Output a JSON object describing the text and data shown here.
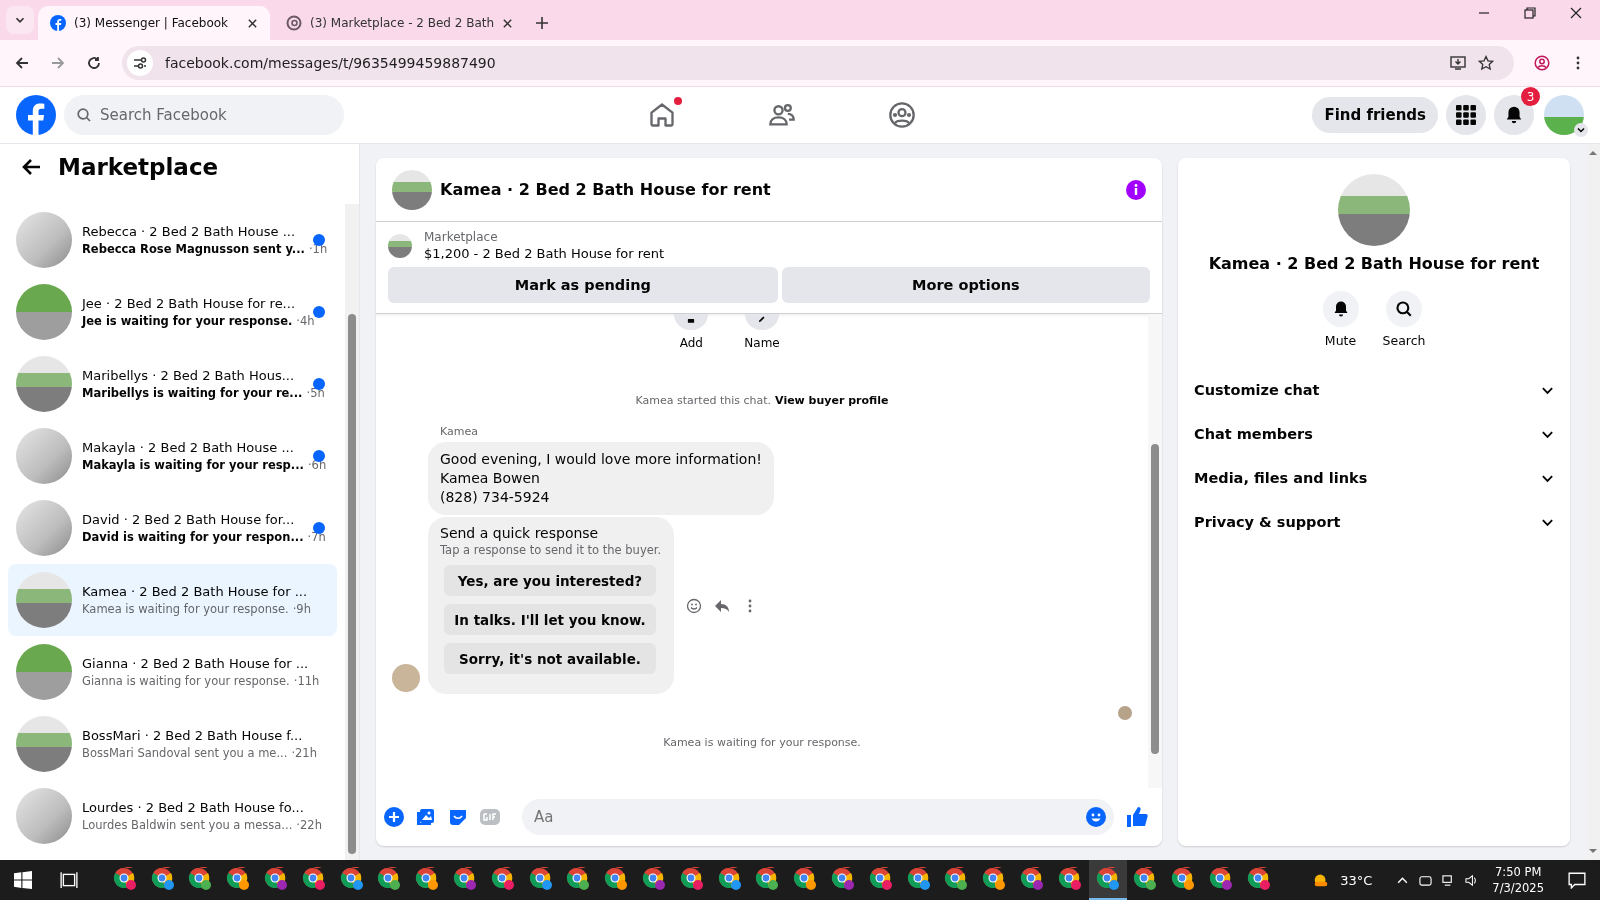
{
  "browser": {
    "tabs": [
      {
        "title": "(3) Messenger | Facebook",
        "selected": true,
        "kind": "facebook"
      },
      {
        "title": "(3) Marketplace - 2 Bed 2 Bath",
        "selected": false,
        "kind": "threads"
      }
    ],
    "url": "facebook.com/messages/t/9635499459887490"
  },
  "header": {
    "search_placeholder": "Search Facebook",
    "home_badge": true,
    "find_friends": "Find friends",
    "notifications_count": "3"
  },
  "sidebar": {
    "title": "Marketplace",
    "conversations": [
      {
        "title": "Rebecca · 2 Bed 2 Bath House ...",
        "preview": "Rebecca Rose Magnusson sent y...",
        "time": "·1h",
        "unread": true,
        "selected": false
      },
      {
        "title": "Jee · 2 Bed 2 Bath House for re...",
        "preview": "Jee is waiting for your response.",
        "time": "·4h",
        "unread": true,
        "selected": false
      },
      {
        "title": "Maribellys · 2 Bed 2 Bath Hous...",
        "preview": "Maribellys is waiting for your re...",
        "time": "·5h",
        "unread": true,
        "selected": false
      },
      {
        "title": "Makayla · 2 Bed 2 Bath House ...",
        "preview": "Makayla is waiting for your resp...",
        "time": "·6h",
        "unread": true,
        "selected": false
      },
      {
        "title": "David · 2 Bed 2 Bath House for...",
        "preview": "David is waiting for your respon...",
        "time": "·7h",
        "unread": true,
        "selected": false
      },
      {
        "title": "Kamea · 2 Bed 2 Bath House for ...",
        "preview": "Kamea is waiting for your response.",
        "time": "·9h",
        "unread": false,
        "selected": true
      },
      {
        "title": "Gianna · 2 Bed 2 Bath House for ...",
        "preview": "Gianna is waiting for your response.",
        "time": "·11h",
        "unread": false,
        "selected": false
      },
      {
        "title": "BossMari · 2 Bed 2 Bath House f...",
        "preview": "BossMari Sandoval sent you a me...",
        "time": "·21h",
        "unread": false,
        "selected": false
      },
      {
        "title": "Lourdes · 2 Bed 2 Bath House fo...",
        "preview": "Lourdes Baldwin sent you a messa...",
        "time": "·22h",
        "unread": false,
        "selected": false
      }
    ]
  },
  "chat": {
    "title": "Kamea · 2 Bed 2 Bath House for rent",
    "listing": {
      "source": "Marketplace",
      "name": "$1,200 - 2 Bed 2 Bath House for rent"
    },
    "actions": [
      "Mark as pending",
      "More options"
    ],
    "quick_actions": [
      "Add",
      "Name"
    ],
    "started_text": "Kamea started this chat.",
    "buyer_link": "View buyer profile",
    "sender": "Kamea",
    "message_lines": [
      "Good evening, I would love more information!",
      "Kamea Bowen",
      "(828) 734-5924"
    ],
    "quick_response": {
      "title": "Send a quick response",
      "hint": "Tap a response to send it to the buyer.",
      "options": [
        "Yes, are you interested?",
        "In talks. I'll let you know.",
        "Sorry, it's not available."
      ]
    },
    "status": "Kamea is waiting for your response.",
    "composer_placeholder": "Aa"
  },
  "details": {
    "title": "Kamea · 2 Bed 2 Bath House for rent",
    "actions": [
      "Mute",
      "Search"
    ],
    "sections": [
      "Customize chat",
      "Chat members",
      "Media, files and links",
      "Privacy & support"
    ]
  },
  "taskbar": {
    "apps": [
      {
        "active": false
      },
      {
        "active": false
      },
      {
        "active": false
      },
      {
        "active": false
      },
      {
        "active": false
      },
      {
        "active": false
      },
      {
        "active": false
      },
      {
        "active": false
      },
      {
        "active": false
      },
      {
        "active": false
      },
      {
        "active": false
      },
      {
        "active": false
      },
      {
        "active": false
      },
      {
        "active": false
      },
      {
        "active": false
      },
      {
        "active": false
      },
      {
        "active": false
      },
      {
        "active": false
      },
      {
        "active": false
      },
      {
        "active": false
      },
      {
        "active": false
      },
      {
        "active": false
      },
      {
        "active": false
      },
      {
        "active": false
      },
      {
        "active": false
      },
      {
        "active": false
      },
      {
        "active": true
      },
      {
        "active": false
      },
      {
        "active": false
      },
      {
        "active": false
      },
      {
        "active": false
      }
    ],
    "temperature": "33°C",
    "time": "7:50 PM",
    "date": "7/3/2025"
  }
}
